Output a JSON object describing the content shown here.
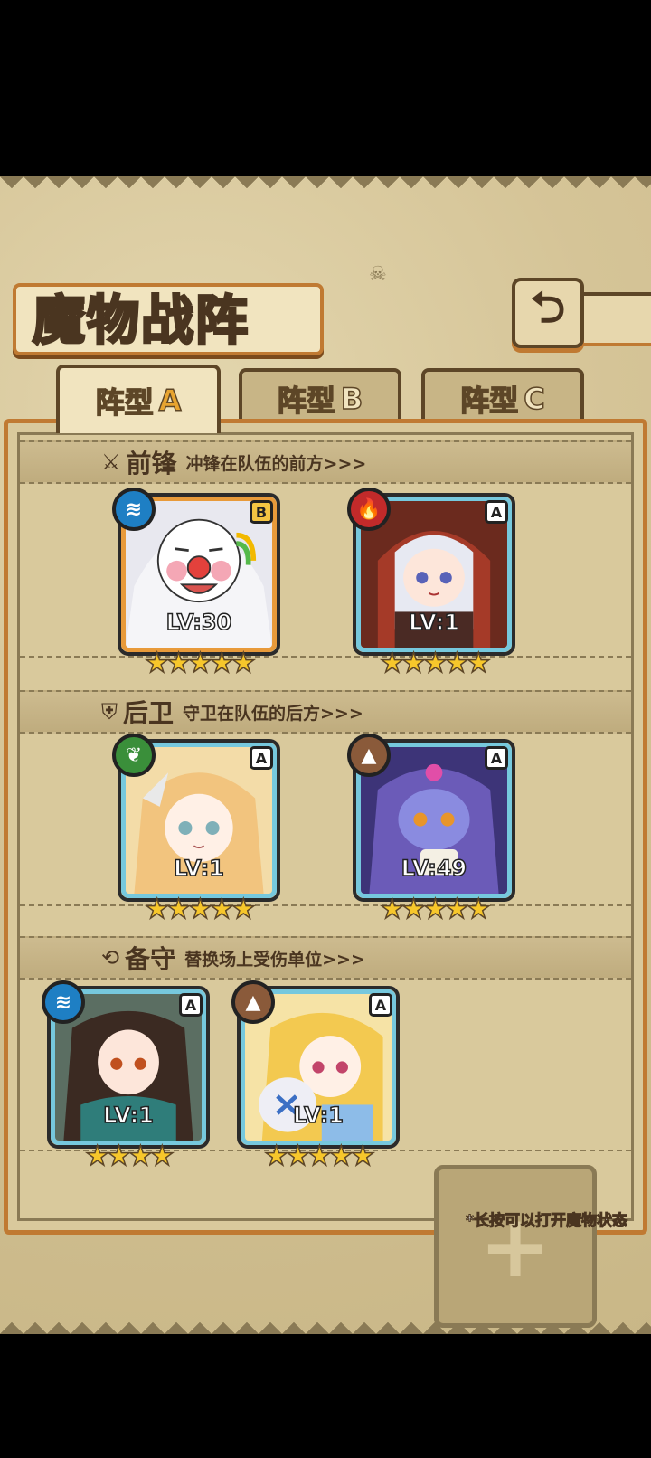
{
  "screen": {
    "title": "魔物战阵",
    "back_icon": "back-arrow-icon"
  },
  "tabs": [
    {
      "label": "阵型",
      "suffix": "A",
      "active": true
    },
    {
      "label": "阵型",
      "suffix": "B",
      "active": false
    },
    {
      "label": "阵型",
      "suffix": "C",
      "active": false
    }
  ],
  "sections": {
    "front": {
      "icon": "sword-icon",
      "name": "前锋",
      "desc": "冲锋在队伍的前方>>>"
    },
    "back": {
      "icon": "shield-icon",
      "name": "后卫",
      "desc": "守卫在队伍的后方>>>"
    },
    "reserve": {
      "icon": "swap-icon",
      "name": "备守",
      "desc": "替换场上受伤单位>>>"
    }
  },
  "cards": [
    {
      "element": "water",
      "grade": "B",
      "level": "LV:30",
      "stars": "★★★★★",
      "accent": "#e89a3a"
    },
    {
      "element": "fire",
      "grade": "A",
      "level": "LV:1",
      "stars": "★★★★★",
      "accent": "#76c8dd"
    },
    {
      "element": "wind",
      "grade": "A",
      "level": "LV:1",
      "stars": "★★★★★",
      "accent": "#76c8dd"
    },
    {
      "element": "earth",
      "grade": "A",
      "level": "LV:49",
      "stars": "★★★★★",
      "accent": "#76c8dd"
    },
    {
      "element": "water",
      "grade": "A",
      "level": "LV:1",
      "stars": "★★★★",
      "accent": "#76c8dd"
    },
    {
      "element": "earth",
      "grade": "A",
      "level": "LV:1",
      "stars": "★★★★★",
      "accent": "#76c8dd"
    }
  ],
  "empty_slot": {
    "icon": "plus-icon",
    "glyph": "+"
  },
  "hint": "*长按可以打开魔物状态"
}
